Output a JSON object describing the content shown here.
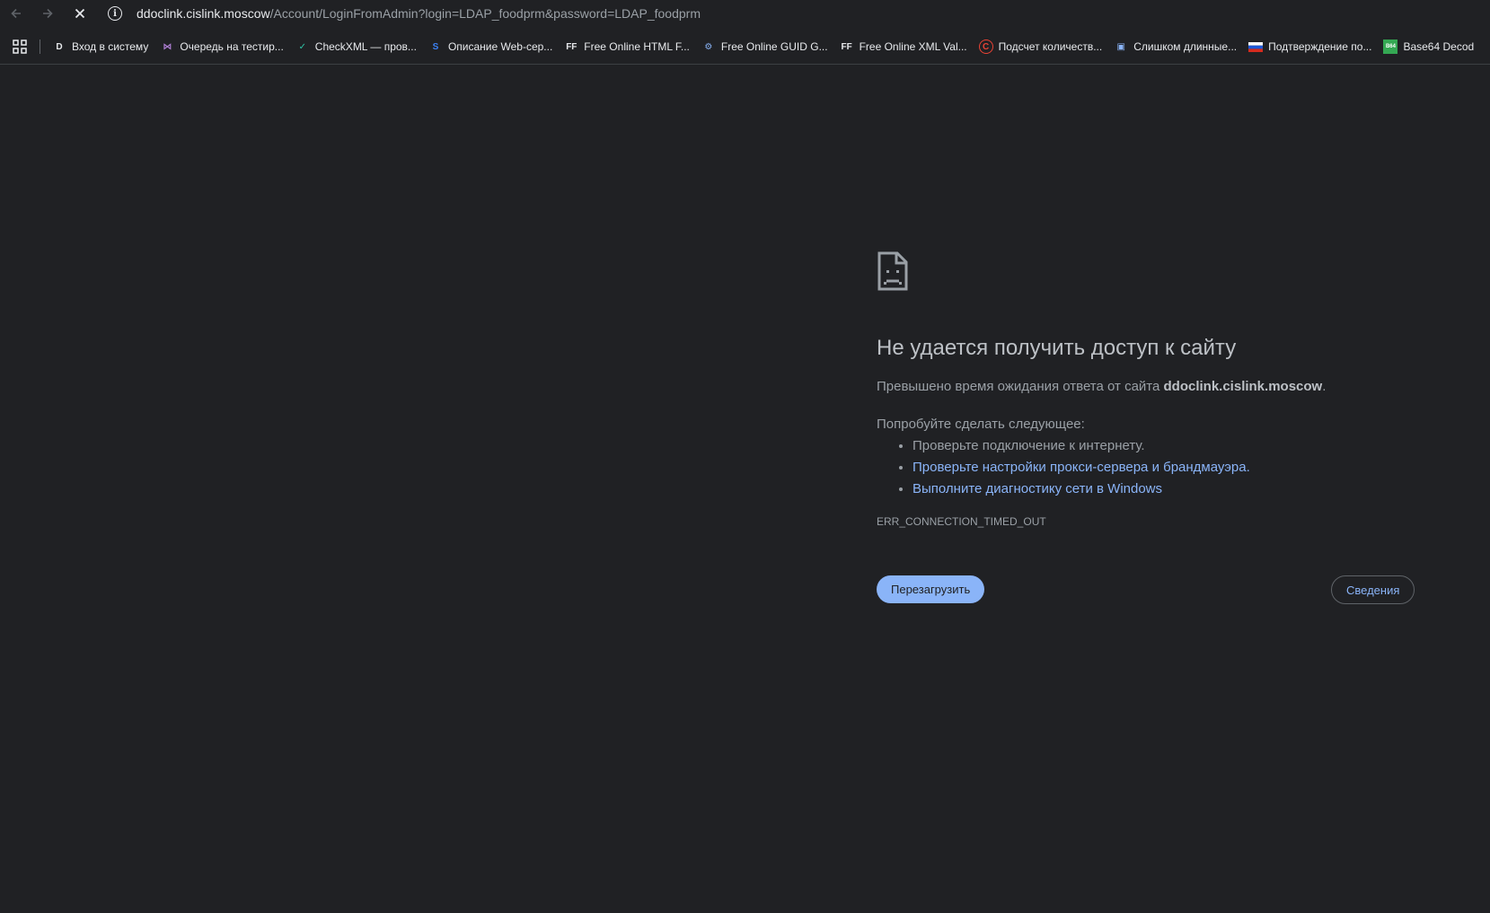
{
  "browser": {
    "url_host": "ddoclink.cislink.moscow",
    "url_path": "/Account/LoginFromAdmin?login=LDAP_foodprm&password=LDAP_foodprm"
  },
  "bookmarks": [
    {
      "label": "Вход в систему",
      "icon": "d-letter-icon",
      "icon_text": "D",
      "color": "#e8eaed"
    },
    {
      "label": "Очередь на тестир...",
      "icon": "visual-studio-icon",
      "icon_text": "⋈",
      "color": "#b180d7"
    },
    {
      "label": "CheckXML — пров...",
      "icon": "checkxml-icon",
      "icon_text": "✓",
      "color": "#2ec4a6"
    },
    {
      "label": "Описание Web-сер...",
      "icon": "web-service-icon",
      "icon_text": "S",
      "color": "#3b82f6"
    },
    {
      "label": "Free Online HTML F...",
      "icon": "ff-icon",
      "icon_text": "FF",
      "color": "#e8eaed"
    },
    {
      "label": "Free Online GUID G...",
      "icon": "gears-icon",
      "icon_text": "⚙",
      "color": "#8ab4f8"
    },
    {
      "label": "Free Online XML Val...",
      "icon": "ff-icon",
      "icon_text": "FF",
      "color": "#e8eaed"
    },
    {
      "label": "Подсчет количеств...",
      "icon": "copyright-icon",
      "icon_text": "C",
      "color": "#ea4335"
    },
    {
      "label": "Слишком длинные...",
      "icon": "monitor-icon",
      "icon_text": "▣",
      "color": "#8ab4f8"
    },
    {
      "label": "Подтверждение по...",
      "icon": "russian-flag-icon",
      "icon_text": "",
      "color": "#e8eaed"
    },
    {
      "label": "Base64 Decod",
      "icon": "b64-icon",
      "icon_text": "B64",
      "color": "#34a853"
    }
  ],
  "error": {
    "title": "Не удается получить доступ к сайту",
    "desc_prefix": "Превышено время ожидания ответа от сайта ",
    "desc_host": "ddoclink.cislink.moscow",
    "desc_suffix": ".",
    "try_title": "Попробуйте сделать следующее:",
    "suggestion_1": "Проверьте подключение к интернету.",
    "suggestion_2": "Проверьте настройки прокси-сервера и брандмауэра.",
    "suggestion_3": "Выполните диагностику сети в Windows",
    "code": "ERR_CONNECTION_TIMED_OUT",
    "reload_label": "Перезагрузить",
    "details_label": "Сведения"
  },
  "colors": {
    "background": "#202124",
    "link": "#8ab4f8",
    "button": "#8ab4f8"
  }
}
